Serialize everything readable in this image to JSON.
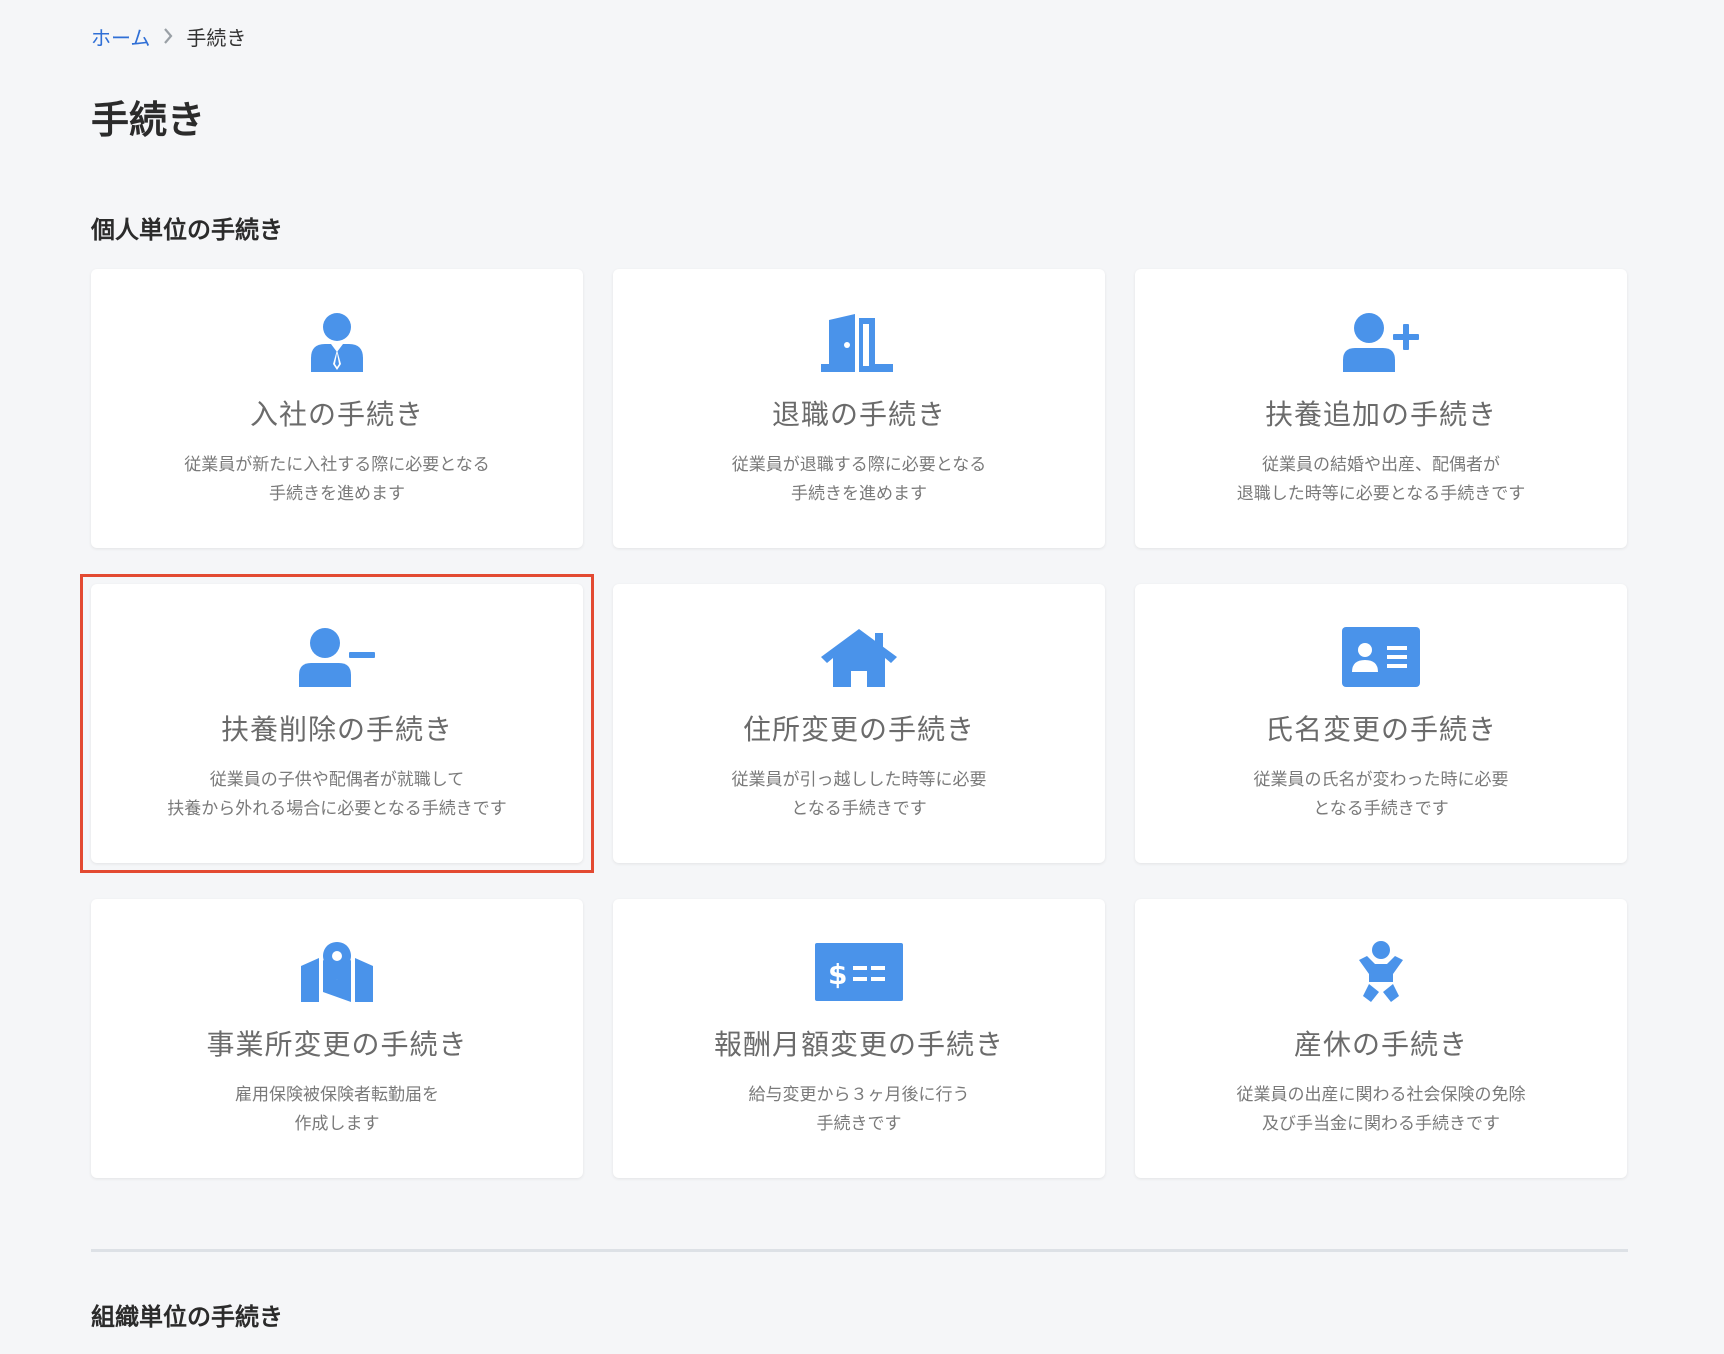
{
  "colors": {
    "accent": "#4a93ea",
    "link": "#2f6fd6",
    "highlight": "#e34a32"
  },
  "breadcrumb": {
    "home": "ホーム",
    "current": "手続き"
  },
  "page_title": "手続き",
  "sections": {
    "individual": "個人単位の手続き",
    "organization": "組織単位の手続き"
  },
  "cards": [
    {
      "icon": "employee-icon",
      "title": "入社の手続き",
      "desc": [
        "従業員が新たに入社する際に必要となる",
        "手続きを進めます"
      ]
    },
    {
      "icon": "door-exit-icon",
      "title": "退職の手続き",
      "desc": [
        "従業員が退職する際に必要となる",
        "手続きを進めます"
      ]
    },
    {
      "icon": "user-plus-icon",
      "title": "扶養追加の手続き",
      "desc": [
        "従業員の結婚や出産、配偶者が",
        "退職した時等に必要となる手続きです"
      ]
    },
    {
      "icon": "user-minus-icon",
      "title": "扶養削除の手続き",
      "desc": [
        "従業員の子供や配偶者が就職して",
        "扶養から外れる場合に必要となる手続きです"
      ]
    },
    {
      "icon": "house-icon",
      "title": "住所変更の手続き",
      "desc": [
        "従業員が引っ越しした時等に必要",
        "となる手続きです"
      ]
    },
    {
      "icon": "id-card-icon",
      "title": "氏名変更の手続き",
      "desc": [
        "従業員の氏名が変わった時に必要",
        "となる手続きです"
      ]
    },
    {
      "icon": "map-marker-icon",
      "title": "事業所変更の手続き",
      "desc": [
        "雇用保険被保険者転勤届を",
        "作成します"
      ]
    },
    {
      "icon": "money-check-icon",
      "title": "報酬月額変更の手続き",
      "desc": [
        "給与変更から３ヶ月後に行う",
        "手続きです"
      ]
    },
    {
      "icon": "baby-icon",
      "title": "産休の手続き",
      "desc": [
        "従業員の出産に関わる社会保険の免除",
        "及び手当金に関わる手続きです"
      ]
    }
  ]
}
